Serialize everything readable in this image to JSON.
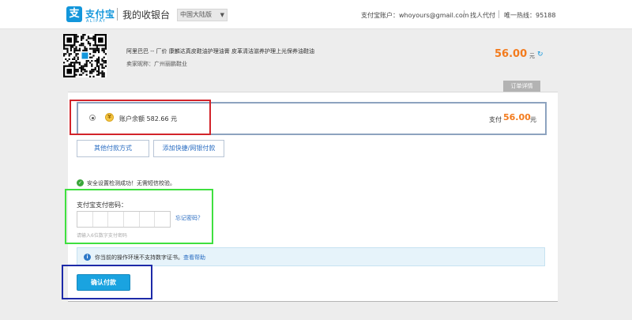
{
  "header": {
    "logo_glyph": "支",
    "logo_cn": "支付宝",
    "logo_en": "ALIPAY",
    "cashier_title": "我的收银台",
    "region": "中国大陆版",
    "account": "支付宝账户：whoyours@gmail.com",
    "agent_pay": "找人代付",
    "hotline": "唯一热线：95188"
  },
  "order": {
    "title": "阿里巴巴 -- 厂价 康麟达真皮鞋油护理油膏 皮革清洁滋养护理上光保养油鞋油",
    "seller": "卖家昵称：广州丽鹏鞋业",
    "amount": "56.00",
    "unit": "元",
    "detail_tab": "订单详情"
  },
  "payment": {
    "coin_glyph": "¥",
    "balance_label": "账户余额 582.66 元",
    "pay_label": "支付",
    "pay_amount": "56.00",
    "pay_unit": "元",
    "other_methods_button": "其他付款方式",
    "add_card_button": "添加快捷/网银付款"
  },
  "security": {
    "check_text": "安全设置检测成功！无需短信校验。",
    "password_label": "支付宝支付密码：",
    "forgot_link": "忘记密码？",
    "password_hint": "请输入6位数字支付密码",
    "password_digits": 6
  },
  "info": {
    "icon_glyph": "i",
    "text": "你当前的操作环境不支持数字证书。",
    "help_link": "查看帮助"
  },
  "confirm_button": "确认付款",
  "colors": {
    "brand_blue": "#1296db",
    "amount_orange": "#f37b1d",
    "confirm_blue": "#1aa3e0",
    "red_annotation": "#d2232a",
    "green_annotation": "#3fe03f",
    "blue_annotation": "#1d2aa8"
  }
}
